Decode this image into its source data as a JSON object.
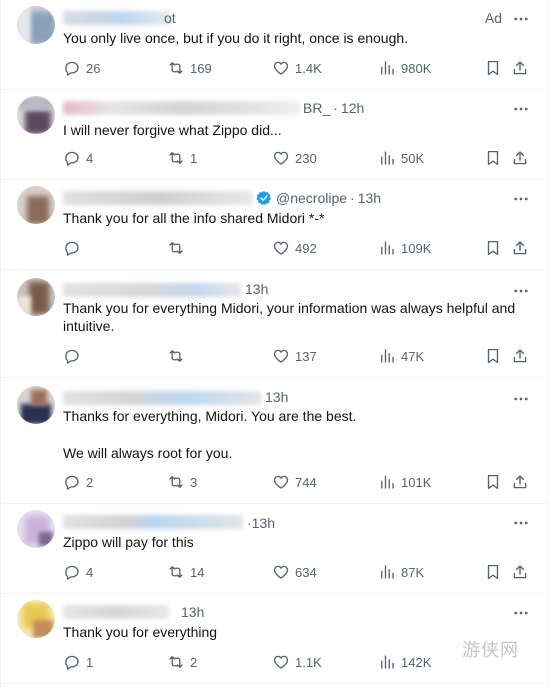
{
  "icons": {
    "reply": "reply-icon",
    "retweet": "retweet-icon",
    "like": "heart-icon",
    "views": "views-icon",
    "bookmark": "bookmark-icon",
    "share": "share-icon",
    "more": "more-dots-icon",
    "verified": "verified-badge-icon"
  },
  "colors": {
    "text": "#0f1419",
    "secondary": "#536471",
    "verified": "#1d9bf0",
    "divider": "#eff3f4"
  },
  "tweets": [
    {
      "handle_suffix": "ot",
      "badge": "Ad",
      "text": [
        "You only live once, but if you do it right, once is enough."
      ],
      "reply_count": "26",
      "retweet_count": "169",
      "like_count": "1.4K",
      "view_count": "980K"
    },
    {
      "handle_suffix": "BR_",
      "time": "12h",
      "text": [
        "I will never forgive what Zippo did..."
      ],
      "reply_count": "4",
      "retweet_count": "1",
      "like_count": "230",
      "view_count": "50K"
    },
    {
      "handle": "@necrolipe",
      "time": "13h",
      "text": [
        "Thank you for all the info shared Midori *-*"
      ],
      "reply_count": "",
      "retweet_count": "",
      "like_count": "492",
      "view_count": "109K"
    },
    {
      "time": "13h",
      "text": [
        "Thank you for everything Midori, your information was always helpful and intuitive."
      ],
      "reply_count": "",
      "retweet_count": "",
      "like_count": "137",
      "view_count": "47K"
    },
    {
      "time": "13h",
      "text": [
        "Thanks for everything, Midori. You are the best.",
        "We will always root for you."
      ],
      "reply_count": "2",
      "retweet_count": "3",
      "like_count": "744",
      "view_count": "101K"
    },
    {
      "time": "13h",
      "text": [
        "Zippo will pay for this"
      ],
      "reply_count": "4",
      "retweet_count": "14",
      "like_count": "634",
      "view_count": "87K"
    },
    {
      "time": "13h",
      "text": [
        "Thank you for everything"
      ],
      "reply_count": "1",
      "retweet_count": "2",
      "like_count": "1.1K",
      "view_count": "142K"
    }
  ],
  "watermark": "游侠网"
}
